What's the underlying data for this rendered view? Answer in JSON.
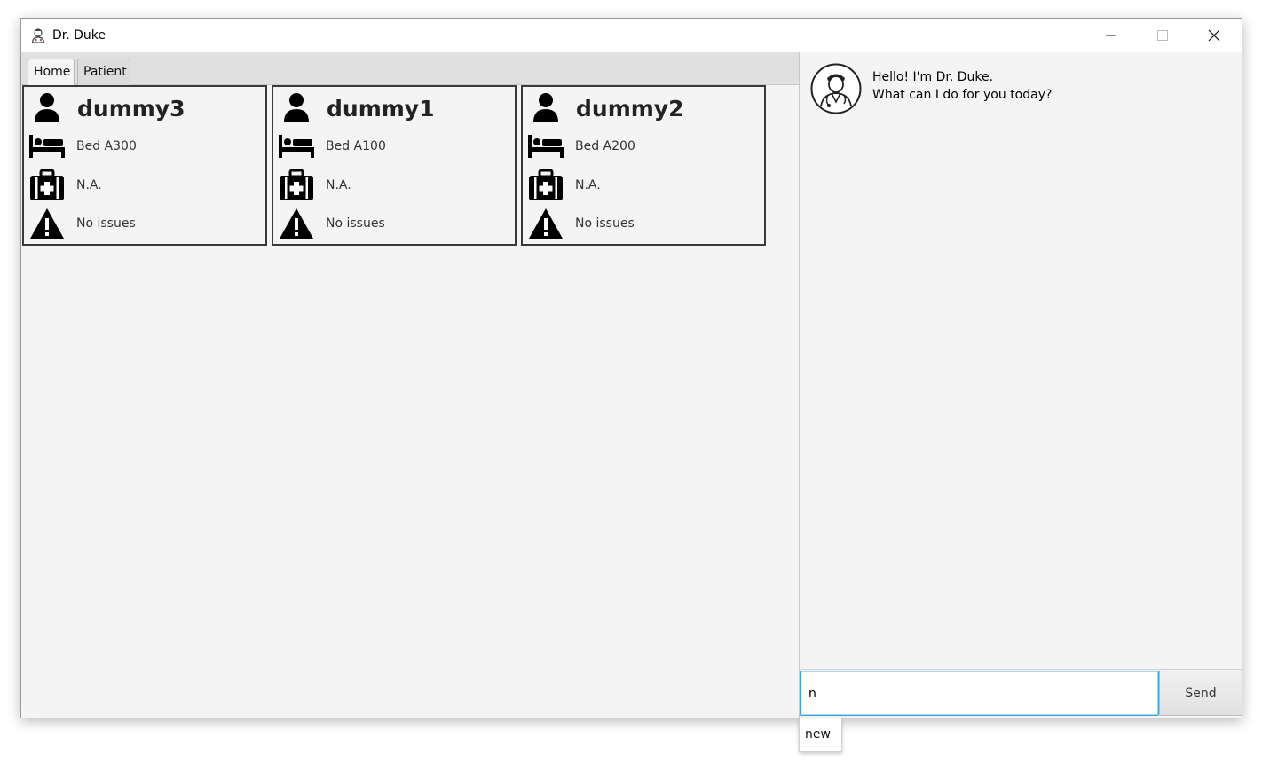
{
  "window": {
    "title": "Dr. Duke"
  },
  "tabs": [
    {
      "label": "Home",
      "active": true
    },
    {
      "label": "Patient",
      "active": false
    }
  ],
  "patients": [
    {
      "name": "dummy3",
      "bed": "Bed A300",
      "condition": "N.A.",
      "issues": "No issues"
    },
    {
      "name": "dummy1",
      "bed": "Bed A100",
      "condition": "N.A.",
      "issues": "No issues"
    },
    {
      "name": "dummy2",
      "bed": "Bed A200",
      "condition": "N.A.",
      "issues": "No issues"
    }
  ],
  "chat": {
    "greeting_line1": "Hello! I'm Dr. Duke.",
    "greeting_line2": "What can I do for you today?",
    "input_value": "n",
    "send_label": "Send",
    "autocomplete": [
      "new"
    ]
  },
  "icons": {
    "app": "doctor-icon",
    "name": "person-icon",
    "bed": "bed-icon",
    "condition": "medkit-icon",
    "issues": "warning-icon"
  },
  "colors": {
    "focus_border": "#3b9fd8",
    "card_border": "#3a3a3a",
    "background": "#f4f4f4"
  }
}
